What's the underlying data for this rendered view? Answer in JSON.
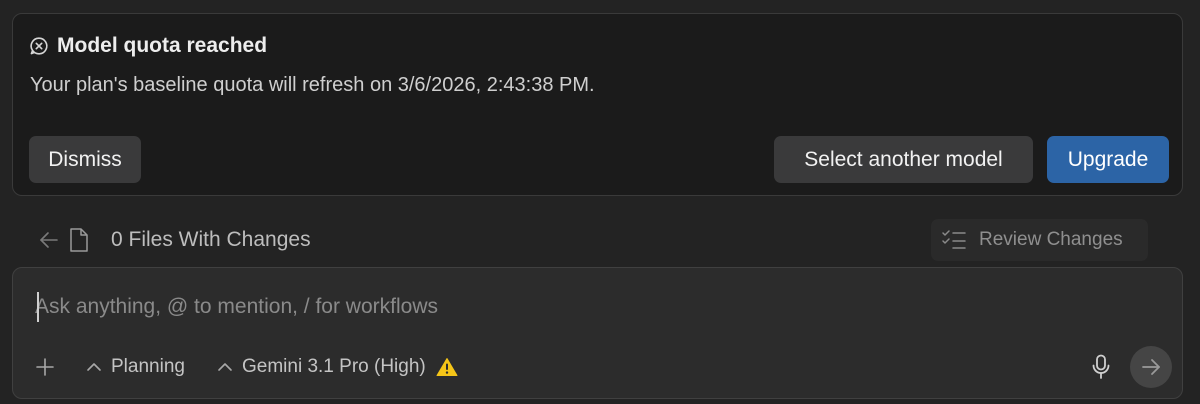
{
  "quota": {
    "title": "Model quota reached",
    "message": "Your plan's baseline quota will refresh on 3/6/2026, 2:43:38 PM.",
    "dismiss_label": "Dismiss",
    "select_model_label": "Select another model",
    "upgrade_label": "Upgrade",
    "icon": "error-circle-icon"
  },
  "files": {
    "label": "0 Files With Changes",
    "review_label": "Review Changes"
  },
  "chat": {
    "placeholder": "Ask anything, @ to mention, / for workflows",
    "value": "",
    "mode_label": "Planning",
    "model_label": "Gemini 3.1 Pro (High)"
  },
  "colors": {
    "accent": "#2c64a6",
    "warning": "#f5c518",
    "card_bg": "#1b1b1b",
    "page_bg": "#232323"
  }
}
